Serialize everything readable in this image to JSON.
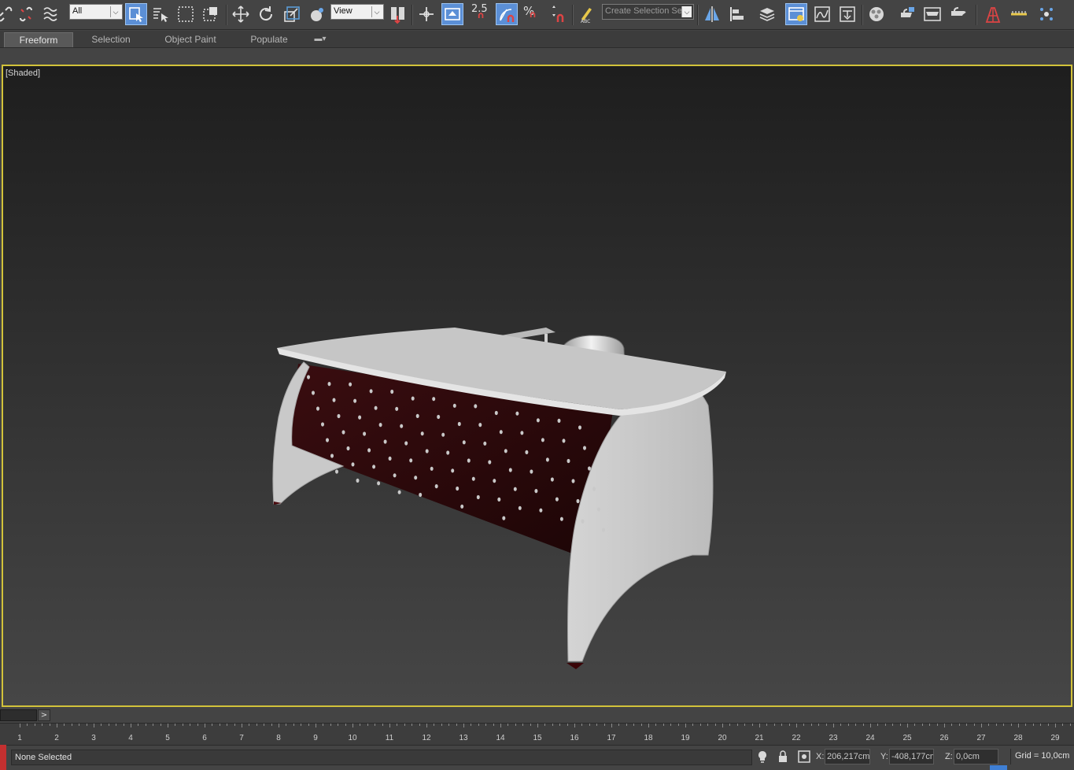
{
  "toolbar": {
    "filter_value": "All",
    "reference_coord_value": "View",
    "snap_angle_label": "2.5",
    "percent_snap_label": "%",
    "selection_set_placeholder": "Create Selection Se",
    "accent_color": "#5b8fd6",
    "icons": [
      "link-icon",
      "unlink-icon",
      "bind-spacewarp-icon",
      "select-object-icon",
      "select-by-name-icon",
      "rect-selection-region-icon",
      "window-crossing-icon",
      "move-icon",
      "rotate-icon",
      "scale-icon",
      "placement-icon",
      "use-pivot-icon",
      "manipulate-icon",
      "keyboard-shortcut-override-icon",
      "snap-toggle-icon",
      "angle-snap-icon",
      "percent-snap-icon",
      "spinner-snap-icon",
      "edit-named-selection-icon",
      "mirror-icon",
      "align-icon",
      "layer-explorer-icon",
      "toggle-scene-explorer-icon",
      "curve-editor-icon",
      "schematic-view-icon",
      "material-editor-icon",
      "render-setup-icon",
      "rendered-frame-window-icon",
      "render-production-icon",
      "render-iterative-icon",
      "a360-cloud-icon",
      "civil-view-icon",
      "tape-measure-icon",
      "particle-view-icon"
    ]
  },
  "ribbon": {
    "tabs": [
      {
        "label": "Freeform",
        "active": true
      },
      {
        "label": "Selection",
        "active": false
      },
      {
        "label": "Object Paint",
        "active": false
      },
      {
        "label": "Populate",
        "active": false
      }
    ],
    "options_icon": "ribbon-options-icon"
  },
  "viewport": {
    "label": "[Shaded]",
    "border_color": "#d2c23a",
    "scene": "office desk with chair"
  },
  "timeline": {
    "next_label": ">",
    "ticks": [
      "1",
      "2",
      "3",
      "4",
      "5",
      "6",
      "7",
      "8",
      "9",
      "10",
      "11",
      "12",
      "13",
      "14",
      "15",
      "16",
      "17",
      "18",
      "19",
      "20",
      "21",
      "22",
      "23",
      "24",
      "25",
      "26",
      "27",
      "28",
      "29"
    ]
  },
  "status": {
    "message": "None Selected",
    "x_label": "X:",
    "x_value": "206,217cm",
    "y_label": "Y:",
    "y_value": "-408,177cm",
    "z_label": "Z:",
    "z_value": "0,0cm",
    "grid": "Grid = 10,0cm"
  }
}
